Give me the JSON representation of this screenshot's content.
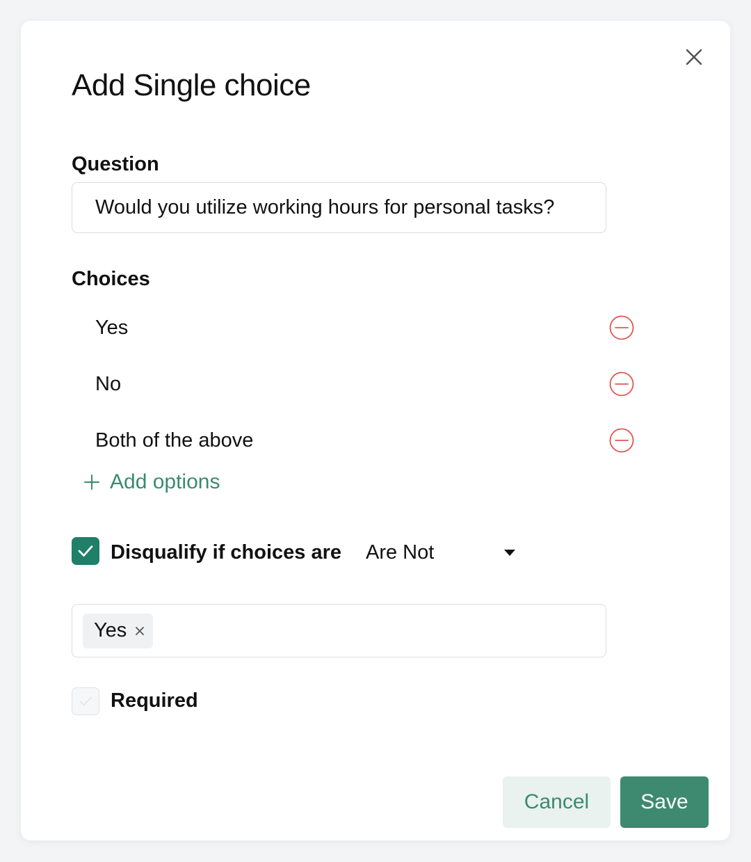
{
  "modal": {
    "title": "Add Single choice",
    "question_label": "Question",
    "question_value": "Would you utilize working hours for personal tasks?",
    "choices_label": "Choices",
    "choices": [
      {
        "label": "Yes"
      },
      {
        "label": "No"
      },
      {
        "label": "Both of the above"
      }
    ],
    "add_options_label": "Add options",
    "disqualify": {
      "checked": true,
      "label": "Disqualify if choices are",
      "condition_value": "Are Not",
      "selected_tags": [
        "Yes"
      ]
    },
    "required": {
      "checked": false,
      "label": "Required"
    },
    "buttons": {
      "cancel": "Cancel",
      "save": "Save"
    }
  },
  "colors": {
    "accent": "#3e8a71",
    "checkbox_checked": "#1f7f68",
    "remove_icon": "#e0574f",
    "cancel_bg": "#e9f2ef"
  },
  "icons": {
    "close": "close-icon",
    "remove": "minus-circle-icon",
    "add": "plus-icon",
    "dropdown": "caret-down-icon",
    "check": "check-icon",
    "tag_remove": "x-icon"
  }
}
